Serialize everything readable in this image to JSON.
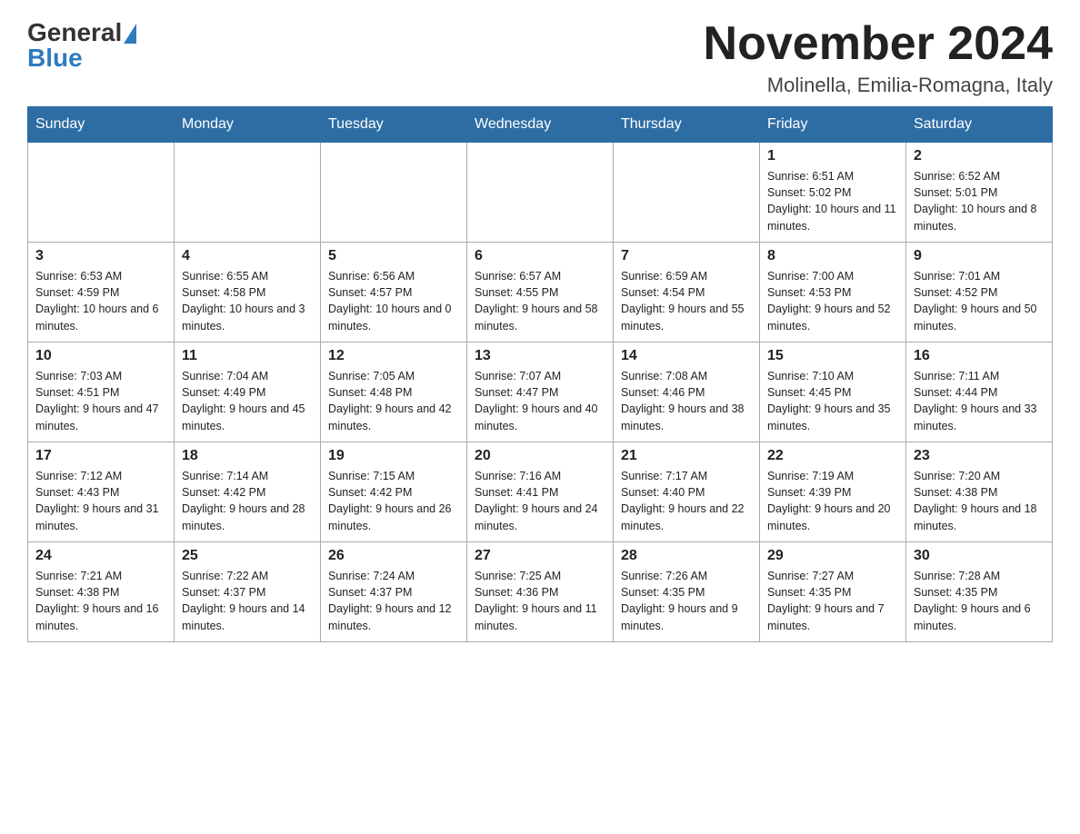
{
  "header": {
    "logo_general": "General",
    "logo_blue": "Blue",
    "title": "November 2024",
    "subtitle": "Molinella, Emilia-Romagna, Italy"
  },
  "days_of_week": [
    "Sunday",
    "Monday",
    "Tuesday",
    "Wednesday",
    "Thursday",
    "Friday",
    "Saturday"
  ],
  "weeks": [
    [
      {
        "day": "",
        "info": ""
      },
      {
        "day": "",
        "info": ""
      },
      {
        "day": "",
        "info": ""
      },
      {
        "day": "",
        "info": ""
      },
      {
        "day": "",
        "info": ""
      },
      {
        "day": "1",
        "info": "Sunrise: 6:51 AM\nSunset: 5:02 PM\nDaylight: 10 hours and 11 minutes."
      },
      {
        "day": "2",
        "info": "Sunrise: 6:52 AM\nSunset: 5:01 PM\nDaylight: 10 hours and 8 minutes."
      }
    ],
    [
      {
        "day": "3",
        "info": "Sunrise: 6:53 AM\nSunset: 4:59 PM\nDaylight: 10 hours and 6 minutes."
      },
      {
        "day": "4",
        "info": "Sunrise: 6:55 AM\nSunset: 4:58 PM\nDaylight: 10 hours and 3 minutes."
      },
      {
        "day": "5",
        "info": "Sunrise: 6:56 AM\nSunset: 4:57 PM\nDaylight: 10 hours and 0 minutes."
      },
      {
        "day": "6",
        "info": "Sunrise: 6:57 AM\nSunset: 4:55 PM\nDaylight: 9 hours and 58 minutes."
      },
      {
        "day": "7",
        "info": "Sunrise: 6:59 AM\nSunset: 4:54 PM\nDaylight: 9 hours and 55 minutes."
      },
      {
        "day": "8",
        "info": "Sunrise: 7:00 AM\nSunset: 4:53 PM\nDaylight: 9 hours and 52 minutes."
      },
      {
        "day": "9",
        "info": "Sunrise: 7:01 AM\nSunset: 4:52 PM\nDaylight: 9 hours and 50 minutes."
      }
    ],
    [
      {
        "day": "10",
        "info": "Sunrise: 7:03 AM\nSunset: 4:51 PM\nDaylight: 9 hours and 47 minutes."
      },
      {
        "day": "11",
        "info": "Sunrise: 7:04 AM\nSunset: 4:49 PM\nDaylight: 9 hours and 45 minutes."
      },
      {
        "day": "12",
        "info": "Sunrise: 7:05 AM\nSunset: 4:48 PM\nDaylight: 9 hours and 42 minutes."
      },
      {
        "day": "13",
        "info": "Sunrise: 7:07 AM\nSunset: 4:47 PM\nDaylight: 9 hours and 40 minutes."
      },
      {
        "day": "14",
        "info": "Sunrise: 7:08 AM\nSunset: 4:46 PM\nDaylight: 9 hours and 38 minutes."
      },
      {
        "day": "15",
        "info": "Sunrise: 7:10 AM\nSunset: 4:45 PM\nDaylight: 9 hours and 35 minutes."
      },
      {
        "day": "16",
        "info": "Sunrise: 7:11 AM\nSunset: 4:44 PM\nDaylight: 9 hours and 33 minutes."
      }
    ],
    [
      {
        "day": "17",
        "info": "Sunrise: 7:12 AM\nSunset: 4:43 PM\nDaylight: 9 hours and 31 minutes."
      },
      {
        "day": "18",
        "info": "Sunrise: 7:14 AM\nSunset: 4:42 PM\nDaylight: 9 hours and 28 minutes."
      },
      {
        "day": "19",
        "info": "Sunrise: 7:15 AM\nSunset: 4:42 PM\nDaylight: 9 hours and 26 minutes."
      },
      {
        "day": "20",
        "info": "Sunrise: 7:16 AM\nSunset: 4:41 PM\nDaylight: 9 hours and 24 minutes."
      },
      {
        "day": "21",
        "info": "Sunrise: 7:17 AM\nSunset: 4:40 PM\nDaylight: 9 hours and 22 minutes."
      },
      {
        "day": "22",
        "info": "Sunrise: 7:19 AM\nSunset: 4:39 PM\nDaylight: 9 hours and 20 minutes."
      },
      {
        "day": "23",
        "info": "Sunrise: 7:20 AM\nSunset: 4:38 PM\nDaylight: 9 hours and 18 minutes."
      }
    ],
    [
      {
        "day": "24",
        "info": "Sunrise: 7:21 AM\nSunset: 4:38 PM\nDaylight: 9 hours and 16 minutes."
      },
      {
        "day": "25",
        "info": "Sunrise: 7:22 AM\nSunset: 4:37 PM\nDaylight: 9 hours and 14 minutes."
      },
      {
        "day": "26",
        "info": "Sunrise: 7:24 AM\nSunset: 4:37 PM\nDaylight: 9 hours and 12 minutes."
      },
      {
        "day": "27",
        "info": "Sunrise: 7:25 AM\nSunset: 4:36 PM\nDaylight: 9 hours and 11 minutes."
      },
      {
        "day": "28",
        "info": "Sunrise: 7:26 AM\nSunset: 4:35 PM\nDaylight: 9 hours and 9 minutes."
      },
      {
        "day": "29",
        "info": "Sunrise: 7:27 AM\nSunset: 4:35 PM\nDaylight: 9 hours and 7 minutes."
      },
      {
        "day": "30",
        "info": "Sunrise: 7:28 AM\nSunset: 4:35 PM\nDaylight: 9 hours and 6 minutes."
      }
    ]
  ]
}
